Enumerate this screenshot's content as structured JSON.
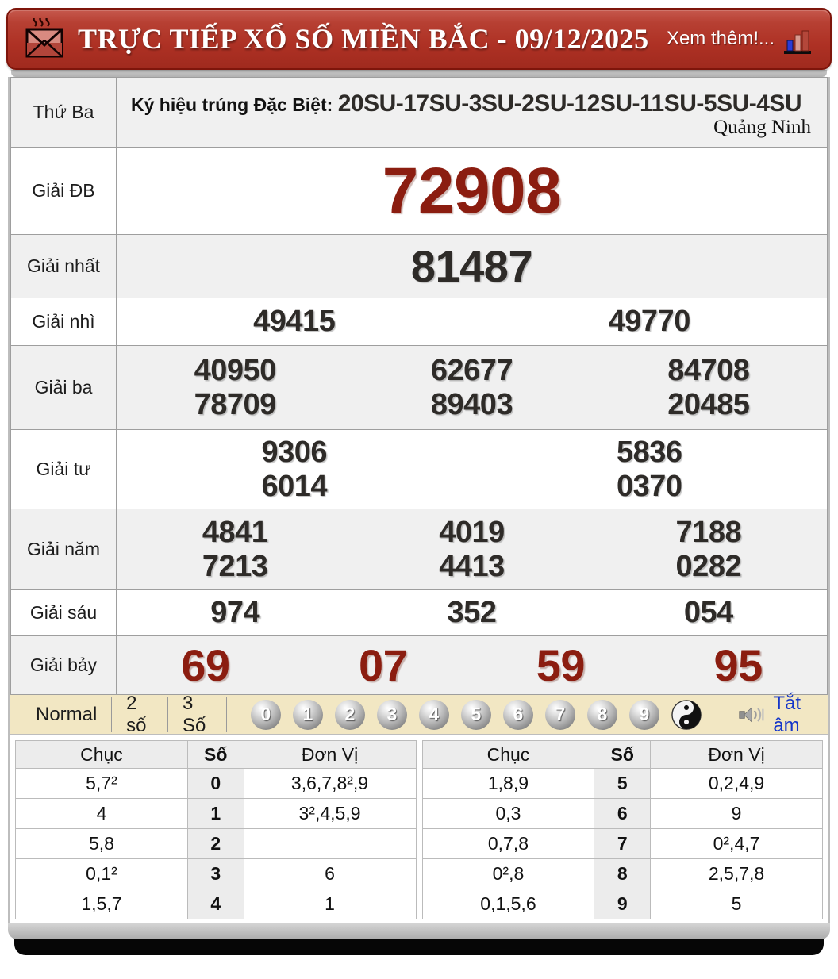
{
  "header": {
    "title": "TRỰC TIẾP XỔ SỐ MIỀN BẮC - 09/12/2025",
    "more_label": "Xem thêm!..."
  },
  "results": {
    "day_label": "Thứ Ba",
    "symbol_prefix": "Ký hiệu trúng Đặc Biệt: ",
    "symbol_value": "20SU-17SU-3SU-2SU-12SU-11SU-5SU-4SU",
    "province": "Quảng Ninh",
    "rows": [
      {
        "label": "Giải ĐB",
        "numbers": [
          [
            "72908"
          ]
        ]
      },
      {
        "label": "Giải nhất",
        "numbers": [
          [
            "81487"
          ]
        ]
      },
      {
        "label": "Giải nhì",
        "numbers": [
          [
            "49415",
            "49770"
          ]
        ]
      },
      {
        "label": "Giải ba",
        "numbers": [
          [
            "40950",
            "62677",
            "84708"
          ],
          [
            "78709",
            "89403",
            "20485"
          ]
        ]
      },
      {
        "label": "Giải tư",
        "numbers": [
          [
            "9306",
            "5836"
          ],
          [
            "6014",
            "0370"
          ]
        ]
      },
      {
        "label": "Giải năm",
        "numbers": [
          [
            "4841",
            "4019",
            "7188"
          ],
          [
            "7213",
            "4413",
            "0282"
          ]
        ]
      },
      {
        "label": "Giải sáu",
        "numbers": [
          [
            "974",
            "352",
            "054"
          ]
        ]
      },
      {
        "label": "Giải bảy",
        "numbers": [
          [
            "69",
            "07",
            "59",
            "95"
          ]
        ]
      }
    ]
  },
  "controls": {
    "modes": [
      "Normal",
      "2 số",
      "3 Số"
    ],
    "balls": [
      "0",
      "1",
      "2",
      "3",
      "4",
      "5",
      "6",
      "7",
      "8",
      "9"
    ],
    "mute_label": "Tắt âm"
  },
  "stats": {
    "headers": [
      "Chục",
      "Số",
      "Đơn Vị"
    ],
    "left_rows": [
      [
        "5,7²",
        "0",
        "3,6,7,8²,9"
      ],
      [
        "4",
        "1",
        "3²,4,5,9"
      ],
      [
        "5,8",
        "2",
        ""
      ],
      [
        "0,1²",
        "3",
        "6"
      ],
      [
        "1,5,7",
        "4",
        "1"
      ]
    ],
    "right_rows": [
      [
        "1,8,9",
        "5",
        "0,2,4,9"
      ],
      [
        "0,3",
        "6",
        "9"
      ],
      [
        "0,7,8",
        "7",
        "0²,4,7"
      ],
      [
        "0²,8",
        "8",
        "2,5,7,8"
      ],
      [
        "0,1,5,6",
        "9",
        "5"
      ]
    ]
  },
  "colors": {
    "banner_red": "#ae3124",
    "number_red": "#8b1d10",
    "cream_bar": "#f2e7c3",
    "alt_row": "#f0f0f0",
    "link_blue": "#1536c9"
  }
}
